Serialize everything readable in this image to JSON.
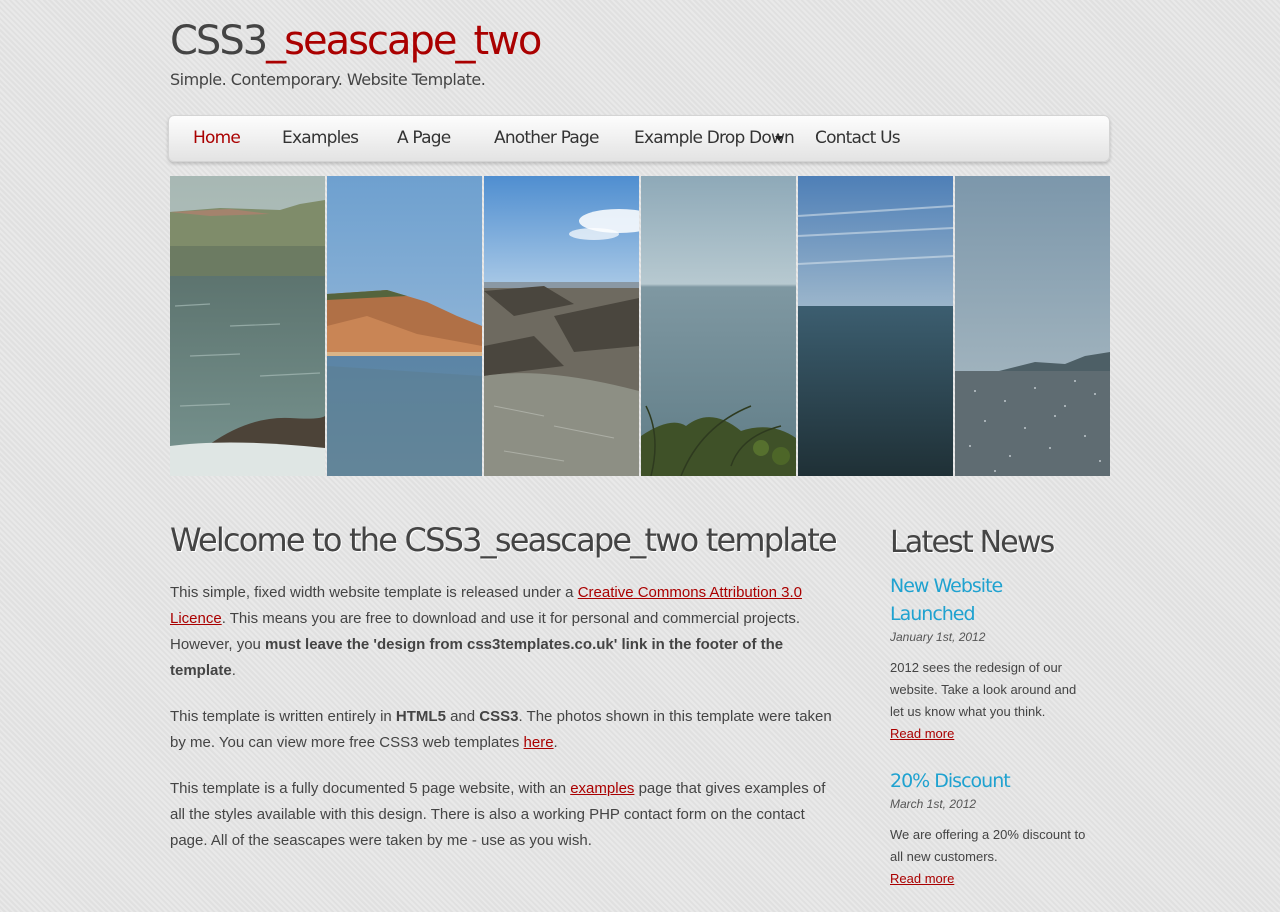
{
  "logo": {
    "title_prefix": "CSS3",
    "title_suffix": "_seascape_two",
    "slogan": "Simple. Contemporary. Website Template."
  },
  "menu": {
    "items": [
      "Home",
      "Examples",
      "A Page",
      "Another Page",
      "Example Drop Down",
      "Contact Us"
    ],
    "selected": "Home"
  },
  "banner": {
    "images": [
      "seascape-1-image",
      "seascape-2-image",
      "seascape-3-image",
      "seascape-4-image",
      "seascape-5-image",
      "seascape-6-image"
    ]
  },
  "content": {
    "heading": "Welcome to the CSS3_seascape_two template",
    "p1": {
      "t1": "This simple, fixed width website template is released under a ",
      "link": "Creative Commons Attribution 3.0 Licence",
      "t2": ". This means you are free to download and use it for personal and commercial projects. However, you ",
      "bold": "must leave the 'design from css3templates.co.uk' link in the footer of the template",
      "t3": "."
    },
    "p2": {
      "t1": "This template is written entirely in ",
      "b1": "HTML5",
      "t2": " and ",
      "b2": "CSS3",
      "t3": ". The photos shown in this template were taken by me. You can view more free CSS3 web templates ",
      "link": "here",
      "t4": "."
    },
    "p3": {
      "t1": "This template is a fully documented 5 page website, with an ",
      "link": "examples",
      "t2": " page that gives examples of all the styles available with this design. There is also a working PHP contact form on the contact page. All of the seascapes were taken by me - use as you wish."
    }
  },
  "sidebar": {
    "heading": "Latest News",
    "news": [
      {
        "title": "New Website Launched",
        "date": "January 1st, 2012",
        "text": "2012 sees the redesign of our website. Take a look around and let us know what you think.",
        "link": "Read more"
      },
      {
        "title": "20% Discount",
        "date": "March 1st, 2012",
        "text": "We are offering a 20% discount to all new customers.",
        "link": "Read more"
      }
    ]
  },
  "colors": {
    "accent": "#aa0000",
    "news_title": "#1fa2d0",
    "text": "#444444",
    "background": "#e4e4e4"
  }
}
